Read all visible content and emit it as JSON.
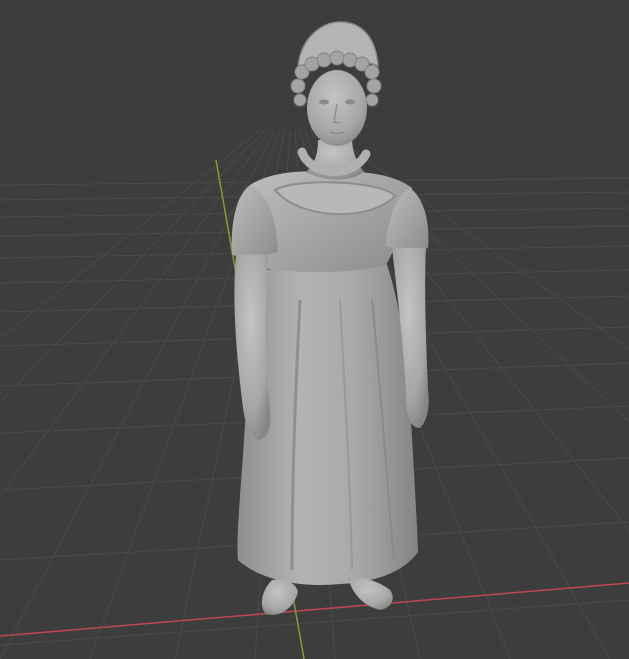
{
  "viewport": {
    "background": "#3d3d3d",
    "grid_color": "#4a4a4a",
    "x_axis_color": "#c0454f",
    "y_axis_color": "#7ea038",
    "model_color": "#a8a8a8",
    "model_shadow": "#7f7f7f",
    "model_highlight": "#c4c4c4",
    "object": "sculpted-figure"
  }
}
